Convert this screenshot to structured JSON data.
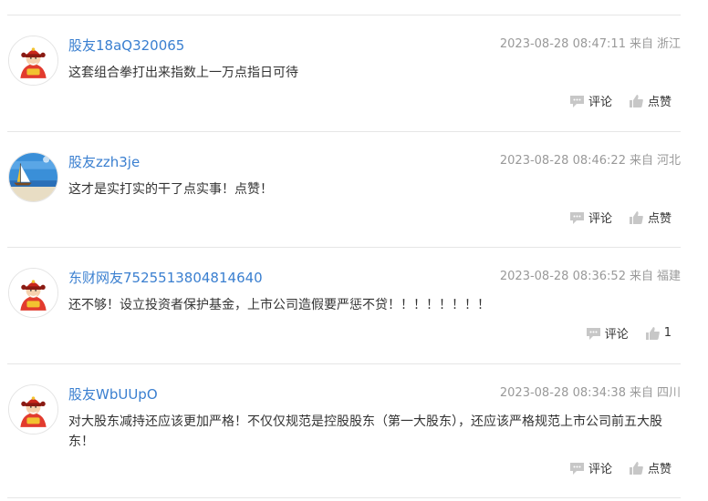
{
  "comments": [
    {
      "username": "股友18aQ320065",
      "timestamp": "2023-08-28 08:47:11",
      "source_prefix": "来自",
      "location": "浙江",
      "content": "这套组合拳打出来指数上一万点指日可待",
      "reply_label": "评论",
      "like_label": "点赞",
      "avatar_icon": "fortune-god-avatar"
    },
    {
      "username": "股友zzh3je",
      "timestamp": "2023-08-28 08:46:22",
      "source_prefix": "来自",
      "location": "河北",
      "content": "这才是实打实的干了点实事！点赞！",
      "reply_label": "评论",
      "like_label": "点赞",
      "avatar_icon": "sailboat-beach-avatar"
    },
    {
      "username": "东财网友7525513804814640",
      "timestamp": "2023-08-28 08:36:52",
      "source_prefix": "来自",
      "location": "福建",
      "content": "还不够！设立投资者保护基金，上市公司造假要严惩不贷！！！！！！！！",
      "reply_label": "评论",
      "like_label": "1",
      "avatar_icon": "fortune-god-avatar"
    },
    {
      "username": "股友WbUUpO",
      "timestamp": "2023-08-28 08:34:38",
      "source_prefix": "来自",
      "location": "四川",
      "content": "对大股东减持还应该更加严格！不仅仅规范是控股股东（第一大股东），还应该严格规范上市公司前五大股东！",
      "reply_label": "评论",
      "like_label": "点赞",
      "avatar_icon": "fortune-god-avatar"
    }
  ],
  "colors": {
    "username": "#3a7fd0",
    "meta": "#999999",
    "text": "#333333",
    "icon": "#c7c7c7",
    "divider": "#e6e6e6"
  }
}
